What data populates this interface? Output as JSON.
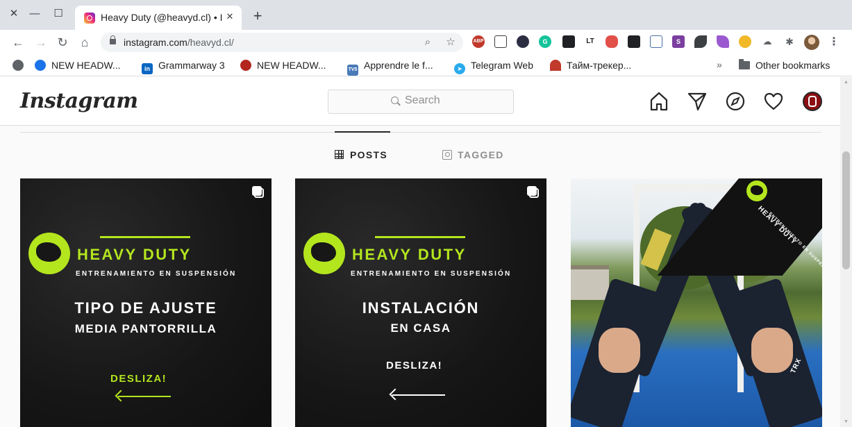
{
  "browser": {
    "tab_title": "Heavy Duty (@heavyd.cl) • Instagram photos and videos",
    "url_host": "instagram.com",
    "url_path": "/heavyd.cl/",
    "bookmarks": [
      {
        "label": "NEW HEADW...",
        "icon": "globe-icon",
        "color": "#1a73e8"
      },
      {
        "label": "Grammarway 3",
        "icon": "linkedin-icon",
        "color": "#0a66c2"
      },
      {
        "label": "NEW HEADW...",
        "icon": "clover-icon",
        "color": "#b3261e"
      },
      {
        "label": "Apprendre le f...",
        "icon": "tv5-icon",
        "color": "#4a7ab8"
      },
      {
        "label": "Telegram Web",
        "icon": "telegram-icon",
        "color": "#2aabee"
      },
      {
        "label": "Тайм-трекер...",
        "icon": "timer-icon",
        "color": "#c0392b"
      }
    ],
    "overflow": "»",
    "other_bookmarks": "Other bookmarks"
  },
  "instagram": {
    "logo": "Instagram",
    "search_placeholder": "Search",
    "tabs": {
      "posts": "POSTS",
      "tagged": "TAGGED"
    },
    "posts": [
      {
        "brand": "HEAVY DUTY",
        "sub": "ENTRENAMIENTO EN SUSPENSIÓN",
        "line1": "TIPO DE AJUSTE",
        "line2": "MEDIA PANTORRILLA",
        "cta": "DESLIZA!",
        "cta_color": "#b4e61e"
      },
      {
        "brand": "HEAVY DUTY",
        "sub": "ENTRENAMIENTO EN SUSPENSIÓN",
        "line1": "INSTALACIÓN",
        "line2": "EN CASA",
        "cta": "DESLIZA!",
        "cta_color": "#ffffff"
      },
      {
        "corner_brand": "HEAVY DUTY",
        "corner_sub": "ENTRENAMIENTO EN SUSPENSIÓN",
        "strap_label": "TRX"
      }
    ]
  }
}
